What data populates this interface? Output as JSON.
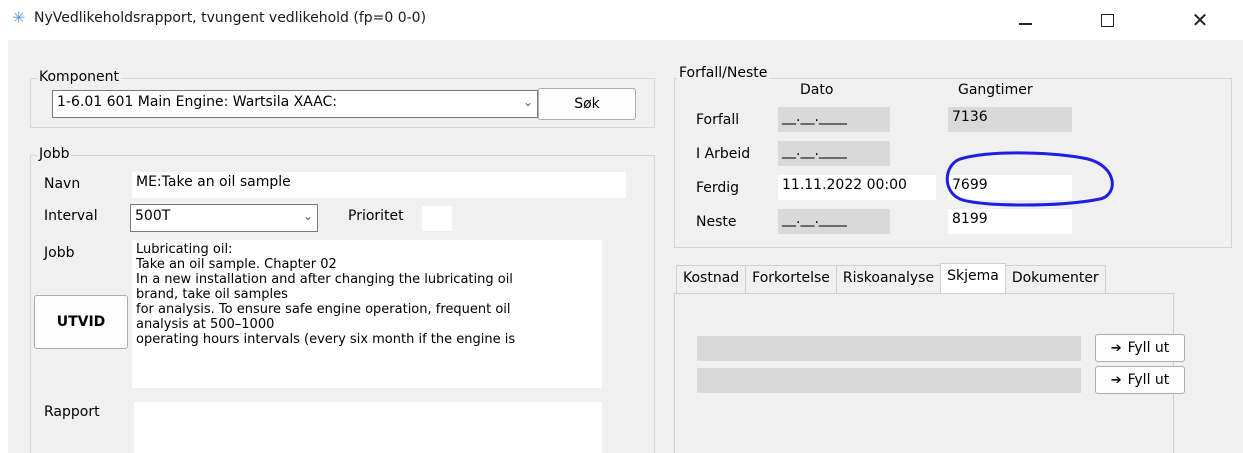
{
  "window": {
    "title": "NyVedlikeholdsrapport, tvungent vedlikehold (fp=0 0-0)",
    "icon": "snowflake-icon",
    "min_glyph": "—",
    "close_glyph": "✕"
  },
  "komponent": {
    "legend": "Komponent",
    "selected": "1-6.01  601 Main Engine: Wartsila  XAAC:",
    "search_label": "Søk"
  },
  "jobb": {
    "legend": "Jobb",
    "navn_label": "Navn",
    "navn_value": "ME:Take an oil sample",
    "interval_label": "Interval",
    "interval_value": "500T",
    "prioritet_label": "Prioritet",
    "prioritet_value": "",
    "jobb_label": "Jobb",
    "jobb_lines": [
      "Lubricating oil:",
      "Take an oil sample. Chapter 02",
      "In a new installation and after changing the lubricating oil",
      "brand, take oil samples",
      "for analysis. To ensure safe engine operation, frequent oil",
      "analysis at 500–1000",
      "operating hours intervals (every six month if the engine is"
    ],
    "utvid_label": "UTVID",
    "rapport_label": "Rapport",
    "rapport_value": ""
  },
  "forfall": {
    "legend": "Forfall/Neste",
    "col_dato": "Dato",
    "col_gangtimer": "Gangtimer",
    "rows": [
      {
        "label": "Forfall",
        "dato": "__.__.____",
        "gangtimer": "7136"
      },
      {
        "label": "I Arbeid",
        "dato": "__.__.____",
        "gangtimer": ""
      },
      {
        "label": "Ferdig",
        "dato": "11.11.2022 00:00",
        "gangtimer": "7699"
      },
      {
        "label": "Neste",
        "dato": "__.__.____",
        "gangtimer": "8199"
      }
    ]
  },
  "tabs": [
    {
      "label": "Kostnad"
    },
    {
      "label": "Forkortelse"
    },
    {
      "label": "Riskoanalyse"
    },
    {
      "label": "Skjema"
    },
    {
      "label": "Dokumenter"
    }
  ],
  "active_tab": "Skjema",
  "skjema": {
    "fill_buttons": [
      {
        "label": "Fyll ut"
      },
      {
        "label": "Fyll ut"
      }
    ]
  },
  "annotation_color": "#1f1fe0"
}
